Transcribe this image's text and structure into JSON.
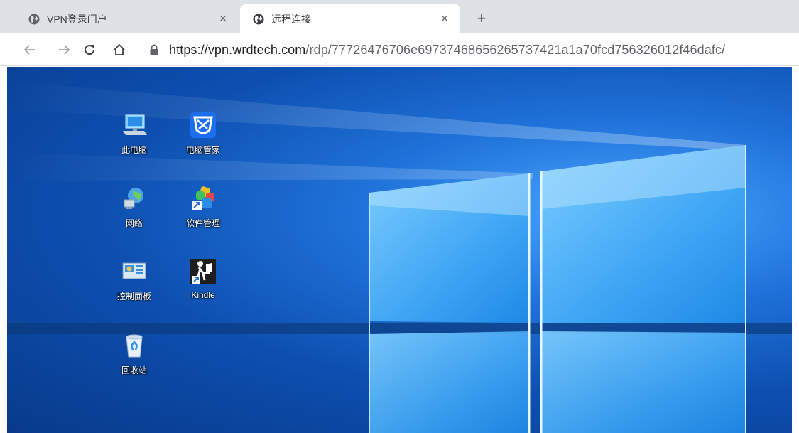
{
  "browser": {
    "tabs": [
      {
        "title": "VPN登录门户",
        "active": false
      },
      {
        "title": "远程连接",
        "active": true
      }
    ],
    "close_glyph": "×",
    "new_tab_glyph": "+",
    "url": {
      "host": "https://vpn.wrdtech.com",
      "path": "/rdp/77726476706e69737468656265737421a1a70fcd756326012f46dafc/"
    }
  },
  "desktop": {
    "icons": [
      {
        "label": "此电脑",
        "icon": "computer-icon"
      },
      {
        "label": "电脑管家",
        "icon": "pc-manager-icon"
      },
      {
        "label": "网络",
        "icon": "network-icon"
      },
      {
        "label": "软件管理",
        "icon": "software-manager-icon"
      },
      {
        "label": "控制面板",
        "icon": "control-panel-icon"
      },
      {
        "label": "Kindle",
        "icon": "kindle-icon"
      },
      {
        "label": "回收站",
        "icon": "recycle-bin-icon"
      }
    ]
  },
  "colors": {
    "tabstrip": "#dee1e6",
    "desktop_blue": "#1f72d9",
    "pc_manager_blue": "#1d6ff2"
  }
}
